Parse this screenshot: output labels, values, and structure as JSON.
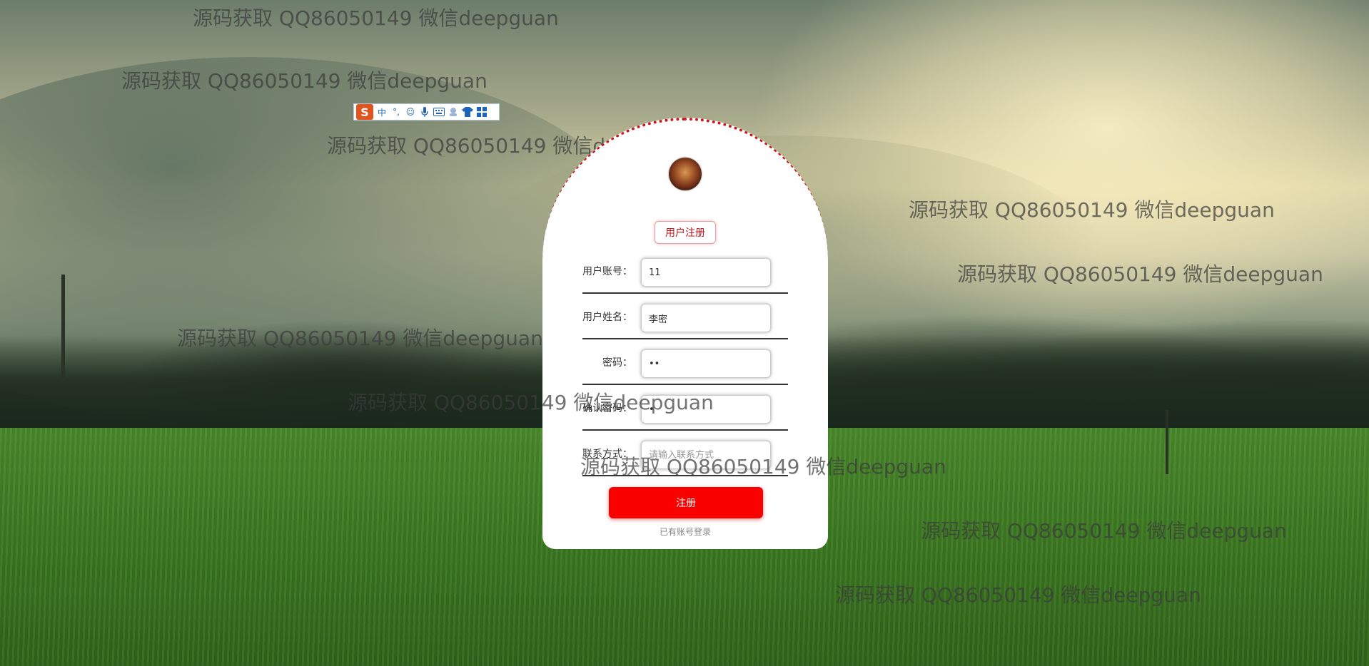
{
  "watermark": {
    "text": "源码获取 QQ86050149 微信deepguan"
  },
  "ime_toolbar": {
    "logo": "S",
    "icons": [
      {
        "name": "chinese-mode-icon",
        "glyph": "中"
      },
      {
        "name": "punctuation-icon",
        "glyph": "°,"
      },
      {
        "name": "emoji-icon",
        "glyph": "☺"
      },
      {
        "name": "microphone-icon",
        "glyph": "🎙"
      },
      {
        "name": "keyboard-icon",
        "glyph": "⌨"
      },
      {
        "name": "handwriting-icon",
        "glyph": "✍"
      },
      {
        "name": "skin-icon",
        "glyph": "👕"
      },
      {
        "name": "toolbox-icon",
        "glyph": "▦"
      }
    ]
  },
  "form": {
    "title": "用户注册",
    "fields": {
      "account": {
        "label": "用户账号：",
        "value": "11",
        "placeholder": ""
      },
      "name": {
        "label": "用户姓名：",
        "value": "李密",
        "placeholder": ""
      },
      "password": {
        "label": "密码：",
        "value": "11",
        "placeholder": ""
      },
      "confirm": {
        "label": "确认密码：",
        "value": "1",
        "placeholder": ""
      },
      "contact": {
        "label": "联系方式：",
        "value": "",
        "placeholder": "请输入联系方式"
      }
    },
    "submit_label": "注册",
    "login_link": "已有账号登录"
  },
  "colors": {
    "accent_red": "#fb0000",
    "title_red": "#c0151e",
    "dotted_border": "#d0161f"
  }
}
